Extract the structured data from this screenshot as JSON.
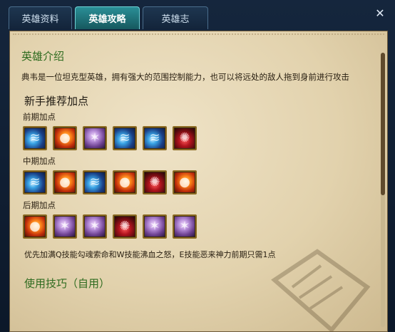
{
  "tabs": [
    {
      "label": "英雄资料",
      "active": false
    },
    {
      "label": "英雄攻略",
      "active": true
    },
    {
      "label": "英雄志",
      "active": false
    }
  ],
  "close_glyph": "✕",
  "intro": {
    "title": "英雄介绍",
    "text": "典韦是一位坦克型英雄，拥有强大的范围控制能力，也可以将远处的敌人拖到身前进行攻击"
  },
  "recommend": {
    "title": "新手推荐加点",
    "early": {
      "label": "前期加点",
      "icons": [
        "blue",
        "fire",
        "purple",
        "blue",
        "blue",
        "blood"
      ]
    },
    "mid": {
      "label": "中期加点",
      "icons": [
        "blue",
        "fire",
        "blue",
        "fire",
        "blood",
        "fire"
      ]
    },
    "late": {
      "label": "后期加点",
      "icons": [
        "fire",
        "purple",
        "purple",
        "blood",
        "purple",
        "purple"
      ]
    },
    "note": "优先加满Q技能勾魂索命和W技能沸血之怒，E技能恶来神力前期只需1点"
  },
  "usage": {
    "title": "使用技巧（自用）"
  },
  "icon_names": {
    "blue": "water-skill-icon",
    "fire": "fire-skill-icon",
    "purple": "claw-skill-icon",
    "blood": "blood-skill-icon"
  }
}
